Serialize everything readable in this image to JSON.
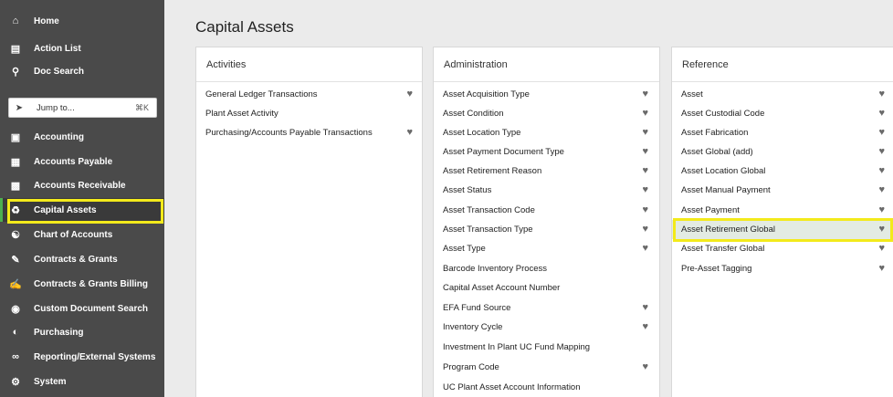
{
  "sidebar": {
    "items": [
      {
        "label": "Home",
        "icon": "home-icon"
      },
      {
        "label": "Action List",
        "icon": "clipboard-icon"
      },
      {
        "label": "Doc Search",
        "icon": "search-icon"
      },
      {
        "label": "Accounting",
        "icon": "file-icon"
      },
      {
        "label": "Accounts Payable",
        "icon": "invoice-icon"
      },
      {
        "label": "Accounts Receivable",
        "icon": "building-icon"
      },
      {
        "label": "Capital Assets",
        "icon": "bank-icon"
      },
      {
        "label": "Chart of Accounts",
        "icon": "sitemap-icon"
      },
      {
        "label": "Contracts & Grants",
        "icon": "contract-icon"
      },
      {
        "label": "Contracts & Grants Billing",
        "icon": "billing-icon"
      },
      {
        "label": "Custom Document Search",
        "icon": "doc-search-icon"
      },
      {
        "label": "Purchasing",
        "icon": "cart-icon"
      },
      {
        "label": "Reporting/External Systems",
        "icon": "link-icon"
      },
      {
        "label": "System",
        "icon": "gear-icon"
      }
    ],
    "jump": {
      "label": "Jump to...",
      "shortcut": "⌘K"
    }
  },
  "page": {
    "title": "Capital Assets"
  },
  "panels": {
    "activities": {
      "title": "Activities",
      "items": [
        {
          "label": "General Ledger Transactions",
          "fav": true
        },
        {
          "label": "Plant Asset Activity",
          "fav": false
        },
        {
          "label": "Purchasing/Accounts Payable Transactions",
          "fav": true
        }
      ]
    },
    "administration": {
      "title": "Administration",
      "items": [
        {
          "label": "Asset Acquisition Type",
          "fav": true
        },
        {
          "label": "Asset Condition",
          "fav": true
        },
        {
          "label": "Asset Location Type",
          "fav": true
        },
        {
          "label": "Asset Payment Document Type",
          "fav": true
        },
        {
          "label": "Asset Retirement Reason",
          "fav": true
        },
        {
          "label": "Asset Status",
          "fav": true
        },
        {
          "label": "Asset Transaction Code",
          "fav": true
        },
        {
          "label": "Asset Transaction Type",
          "fav": true
        },
        {
          "label": "Asset Type",
          "fav": true
        },
        {
          "label": "Barcode Inventory Process",
          "fav": false
        },
        {
          "label": "Capital Asset Account Number",
          "fav": false
        },
        {
          "label": "EFA Fund Source",
          "fav": true
        },
        {
          "label": "Inventory Cycle",
          "fav": true
        },
        {
          "label": "Investment In Plant UC Fund Mapping",
          "fav": false
        },
        {
          "label": "Program Code",
          "fav": true
        },
        {
          "label": "UC Plant Asset Account Information",
          "fav": false
        }
      ]
    },
    "reference": {
      "title": "Reference",
      "items": [
        {
          "label": "Asset",
          "fav": true
        },
        {
          "label": "Asset Custodial Code",
          "fav": true
        },
        {
          "label": "Asset Fabrication",
          "fav": true
        },
        {
          "label": "Asset Global (add)",
          "fav": true
        },
        {
          "label": "Asset Location Global",
          "fav": true
        },
        {
          "label": "Asset Manual Payment",
          "fav": true
        },
        {
          "label": "Asset Payment",
          "fav": true
        },
        {
          "label": "Asset Retirement Global",
          "fav": true
        },
        {
          "label": "Asset Transfer Global",
          "fav": true
        },
        {
          "label": "Pre-Asset Tagging",
          "fav": true
        }
      ]
    }
  },
  "colors": {
    "highlight": "#f3ea1b",
    "sidebar_bg": "#4a4a4a",
    "active_accent": "#4caf50"
  }
}
